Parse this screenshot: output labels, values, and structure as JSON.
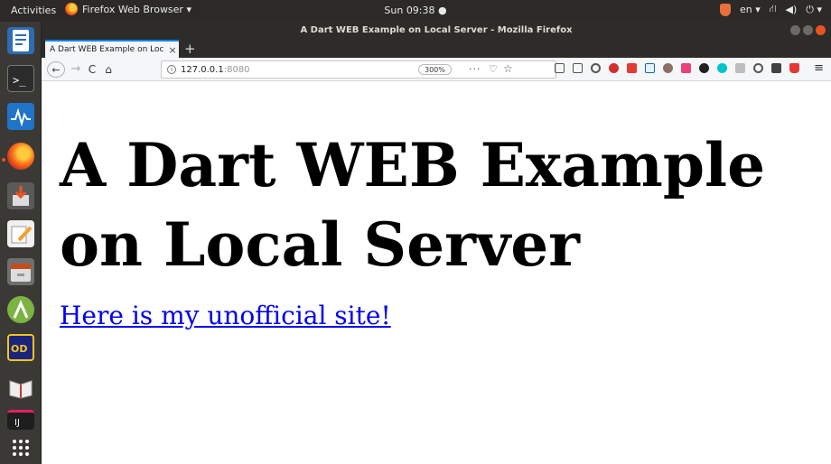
{
  "top_panel": {
    "activities": "Activities",
    "app_menu": "Firefox Web Browser ▾",
    "clock": "Sun 09:38 ●",
    "language": "en ▾",
    "network": "⛙",
    "volume": "◀)",
    "power": "⏻ ▾"
  },
  "window": {
    "title": "A Dart WEB Example on Local Server - Mozilla Firefox"
  },
  "tabs": [
    {
      "title": "A Dart WEB Example on Loc",
      "close": "×"
    }
  ],
  "new_tab": "+",
  "nav": {
    "back": "←",
    "forward": "→",
    "reload": "C",
    "home": "⌂",
    "url_host": "127.0.0.1",
    "url_port": ":8080",
    "info": "i",
    "zoom": "300%",
    "page_actions": "···",
    "pocket": "♡",
    "bookmark": "☆",
    "menu": "≡"
  },
  "page": {
    "heading_line1": "A Dart WEB Example",
    "heading_line2": "on Local Server",
    "link": "Here is my unofficial site!"
  },
  "colors": {
    "accent": "#0a84ff",
    "ubuntu_orange": "#e95420",
    "link": "#0000ee"
  },
  "dock": [
    {
      "name": "libreoffice-writer-icon"
    },
    {
      "name": "terminal-icon"
    },
    {
      "name": "system-monitor-icon"
    },
    {
      "name": "firefox-icon",
      "active": true
    },
    {
      "name": "installer-icon"
    },
    {
      "name": "text-editor-icon"
    },
    {
      "name": "files-icon"
    },
    {
      "name": "android-studio-icon"
    },
    {
      "name": "dart-app-icon"
    },
    {
      "name": "book-reader-icon"
    },
    {
      "name": "intellij-icon"
    },
    {
      "name": "show-applications-icon"
    }
  ]
}
